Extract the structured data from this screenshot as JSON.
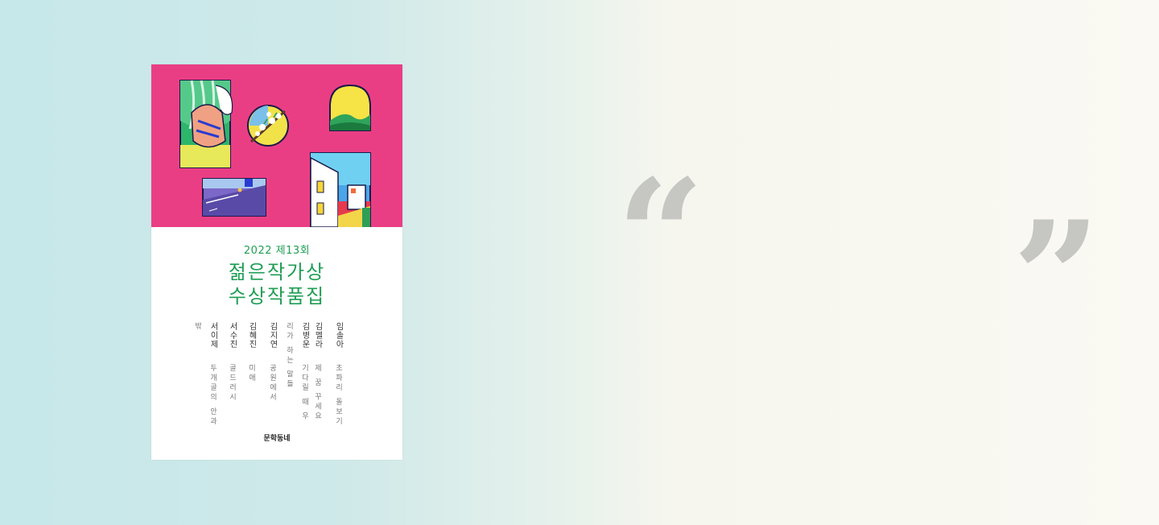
{
  "book": {
    "edition": "2022 제13회",
    "title_line1": "젊은작가상",
    "title_line2": "수상작품집",
    "authors": [
      {
        "name": "임솔아",
        "work": "초파리 돌보기"
      },
      {
        "name": "김멜라",
        "work": "제 꿈 꾸세요"
      },
      {
        "name": "김병운",
        "work": "기다릴 때 우리가 하는 말들"
      },
      {
        "name": "김지연",
        "work": "공원에서"
      },
      {
        "name": "김혜진",
        "work": "미애"
      },
      {
        "name": "서수진",
        "work": "골드러시"
      },
      {
        "name": "서이제",
        "work": "두개골의 안과 밖"
      }
    ],
    "publisher": "문학동네"
  },
  "quotes": {
    "open": "“",
    "close": "”"
  },
  "colors": {
    "cover_pink": "#ea3e84",
    "title_green": "#1f9e55",
    "quote_gray": "#c6c6c3"
  }
}
